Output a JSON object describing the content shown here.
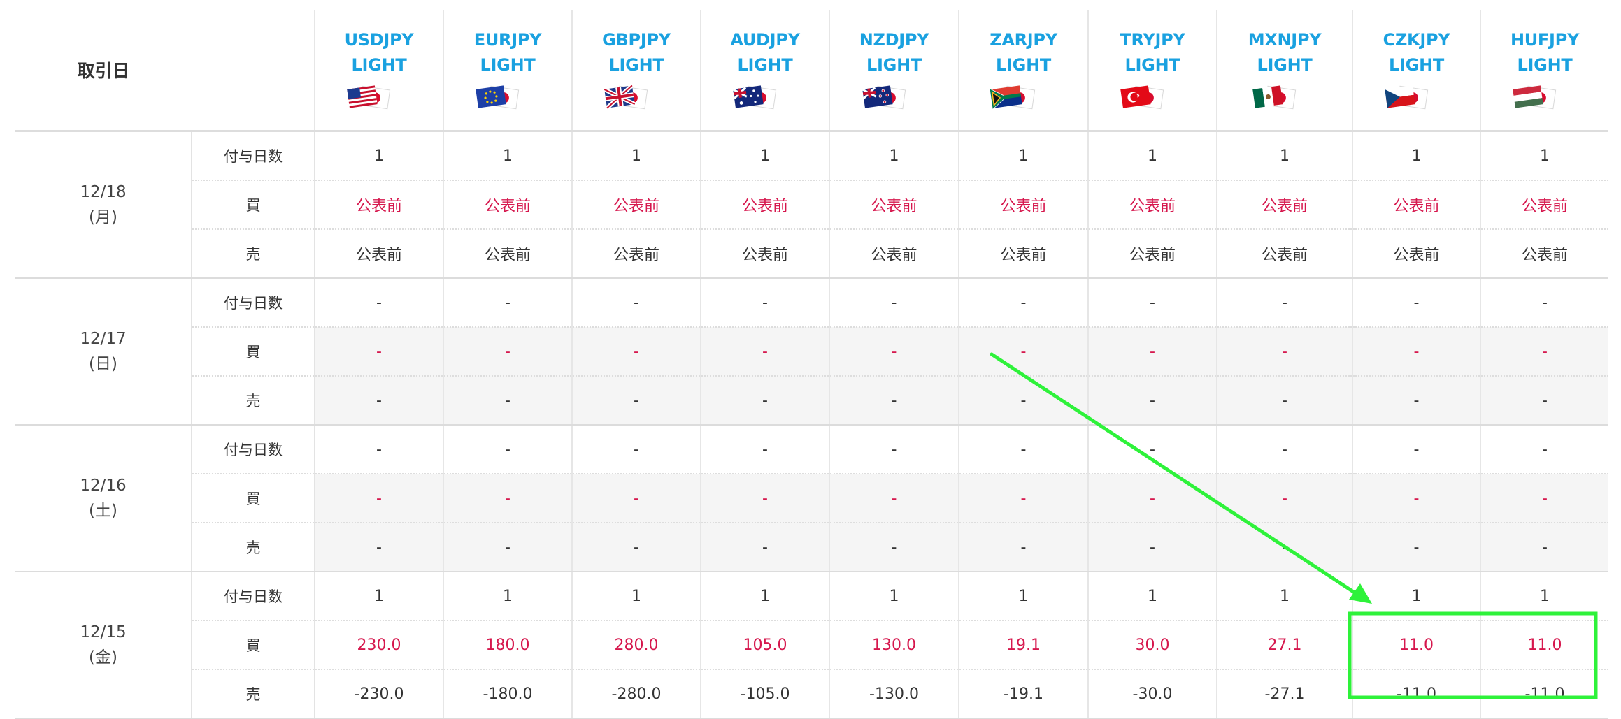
{
  "header": {
    "date_label": "取引日",
    "pairs": [
      {
        "line1": "USDJPY",
        "line2": "LIGHT",
        "flag": "us-jp-flags-icon"
      },
      {
        "line1": "EURJPY",
        "line2": "LIGHT",
        "flag": "eu-jp-flags-icon"
      },
      {
        "line1": "GBPJPY",
        "line2": "LIGHT",
        "flag": "gb-jp-flags-icon"
      },
      {
        "line1": "AUDJPY",
        "line2": "LIGHT",
        "flag": "au-jp-flags-icon"
      },
      {
        "line1": "NZDJPY",
        "line2": "LIGHT",
        "flag": "nz-jp-flags-icon"
      },
      {
        "line1": "ZARJPY",
        "line2": "LIGHT",
        "flag": "za-jp-flags-icon"
      },
      {
        "line1": "TRYJPY",
        "line2": "LIGHT",
        "flag": "tr-jp-flags-icon"
      },
      {
        "line1": "MXNJPY",
        "line2": "LIGHT",
        "flag": "mx-jp-flags-icon"
      },
      {
        "line1": "CZKJPY",
        "line2": "LIGHT",
        "flag": "cz-jp-flags-icon"
      },
      {
        "line1": "HUFJPY",
        "line2": "LIGHT",
        "flag": "hu-jp-flags-icon"
      }
    ]
  },
  "row_labels": {
    "days": "付与日数",
    "buy": "買",
    "sell": "売"
  },
  "days": [
    {
      "date": "12/18",
      "weekday": "(月)",
      "days_values": [
        "1",
        "1",
        "1",
        "1",
        "1",
        "1",
        "1",
        "1",
        "1",
        "1"
      ],
      "buy_values": [
        "公表前",
        "公表前",
        "公表前",
        "公表前",
        "公表前",
        "公表前",
        "公表前",
        "公表前",
        "公表前",
        "公表前"
      ],
      "sell_values": [
        "公表前",
        "公表前",
        "公表前",
        "公表前",
        "公表前",
        "公表前",
        "公表前",
        "公表前",
        "公表前",
        "公表前"
      ]
    },
    {
      "date": "12/17",
      "weekday": "(日)",
      "days_values": [
        "-",
        "-",
        "-",
        "-",
        "-",
        "-",
        "-",
        "-",
        "-",
        "-"
      ],
      "buy_values": [
        "-",
        "-",
        "-",
        "-",
        "-",
        "-",
        "-",
        "-",
        "-",
        "-"
      ],
      "sell_values": [
        "-",
        "-",
        "-",
        "-",
        "-",
        "-",
        "-",
        "-",
        "-",
        "-"
      ]
    },
    {
      "date": "12/16",
      "weekday": "(土)",
      "days_values": [
        "-",
        "-",
        "-",
        "-",
        "-",
        "-",
        "-",
        "-",
        "-",
        "-"
      ],
      "buy_values": [
        "-",
        "-",
        "-",
        "-",
        "-",
        "-",
        "-",
        "-",
        "-",
        "-"
      ],
      "sell_values": [
        "-",
        "-",
        "-",
        "-",
        "-",
        "-",
        "-",
        "-",
        "-",
        "-"
      ]
    },
    {
      "date": "12/15",
      "weekday": "(金)",
      "days_values": [
        "1",
        "1",
        "1",
        "1",
        "1",
        "1",
        "1",
        "1",
        "1",
        "1"
      ],
      "buy_values": [
        "230.0",
        "180.0",
        "280.0",
        "105.0",
        "130.0",
        "19.1",
        "30.0",
        "27.1",
        "11.0",
        "11.0"
      ],
      "sell_values": [
        "-230.0",
        "-180.0",
        "-280.0",
        "-105.0",
        "-130.0",
        "-19.1",
        "-30.0",
        "-27.1",
        "-11.0",
        "-11.0"
      ]
    }
  ],
  "colors": {
    "pair_name": "#1aa1e0",
    "buy_value": "#d6174d",
    "annotation": "#2ef23a",
    "shaded_bg": "#f5f5f5"
  }
}
